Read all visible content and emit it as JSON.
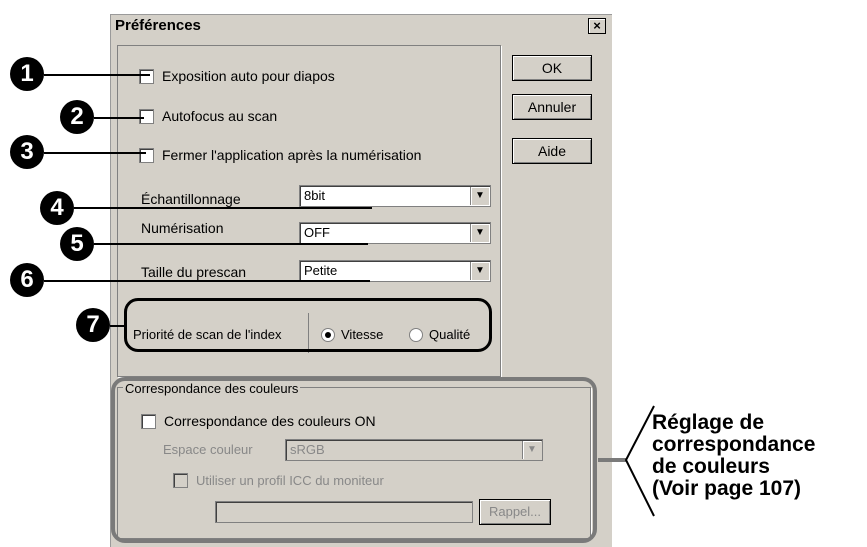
{
  "dialog": {
    "title": "Préférences",
    "close_label": "×"
  },
  "buttons": {
    "ok": "OK",
    "cancel": "Annuler",
    "help": "Aide"
  },
  "checkboxes": {
    "auto_exposure": "Exposition auto pour diapos",
    "autofocus": "Autofocus au scan",
    "close_after": "Fermer l'application après la numérisation"
  },
  "fields": {
    "sampling": {
      "label": "Échantillonnage",
      "value": "8bit"
    },
    "scan_mode": {
      "label": "Numérisation",
      "value": "OFF"
    },
    "prescan_size": {
      "label": "Taille du prescan",
      "value": "Petite"
    }
  },
  "index_priority": {
    "label": "Priorité de scan de l'index",
    "options": [
      "Vitesse",
      "Qualité"
    ],
    "selected": "Vitesse"
  },
  "color_matching": {
    "group_title": "Correspondance des couleurs",
    "enable_label": "Correspondance des couleurs ON",
    "space_label": "Espace couleur",
    "space_value": "sRGB",
    "icc_label": "Utiliser un profil ICC du moniteur",
    "profile_value": "",
    "recall_button": "Rappel..."
  },
  "callouts": [
    "1",
    "2",
    "3",
    "4",
    "5",
    "6",
    "7"
  ],
  "annotation": {
    "line1": "Réglage de",
    "line2": "correspondance",
    "line3": "de couleurs",
    "line4": "(Voir page 107)"
  },
  "colors": {
    "dialog_bg": "#d4d0c8",
    "grey_outline": "#7a7a7a"
  }
}
